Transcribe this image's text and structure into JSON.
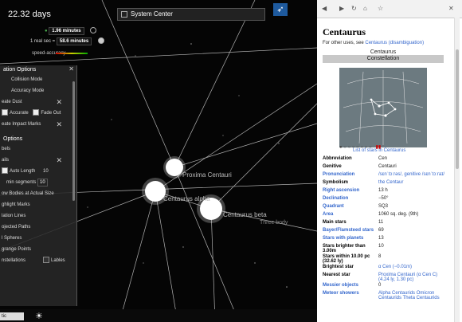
{
  "sim": {
    "elapsed": "22.32 days",
    "rate1": "1.96 minutes",
    "rate2_prefix": "1 real sec =",
    "rate2": "58.6 minutes",
    "accuracy_label": "speed-accuracy"
  },
  "tab": {
    "label": "System Center"
  },
  "stars": {
    "a": "Proxima Centauri",
    "b": "Centaurus alpha",
    "c": "Centaurus beta",
    "d": "Three body"
  },
  "panel": {
    "sim_header": "ation Options",
    "collision": "Collision Mode",
    "accuracy": "Accuracy Mode",
    "create_dust": "eate Dust",
    "accurate": "Accurate",
    "fade_out": "Fade Out",
    "impact": "eate Impact Marks",
    "view_header": "Options",
    "labels": "bels",
    "trails": "ails",
    "auto_length": "Auto Length",
    "auto_length_val": "10",
    "min_segments": "min segments",
    "min_segments_val": "10",
    "show_bodies": "ow Bodies at Actual Size",
    "highlight": "ghlight Marks",
    "relation": "lation Lines",
    "projected": "ojected Paths",
    "spheres": "l Spheres",
    "lagrange": "grange Points",
    "constellations": "nstellations",
    "lables": "Lables"
  },
  "bottom": {
    "select_value": "tic"
  },
  "wiki": {
    "title": "Centaurus",
    "dab_prefix": "For other uses, see",
    "dab_link": "Centaurus (disambiguation)",
    "ib_name": "Centaurus",
    "ib_header": "Constellation",
    "list_link": "List of stars in Centaurus",
    "rows": [
      {
        "k": "Abbreviation",
        "v": "Cen"
      },
      {
        "k": "Genitive",
        "v": "Centauri"
      },
      {
        "k": "Pronunciation",
        "v": "/sɛnˈtɔːrəs/, genitive /sɛnˈtɔːraɪ/"
      },
      {
        "k": "Symbolism",
        "v": "the Centaur"
      },
      {
        "k": "Right ascension",
        "v": "13 h"
      },
      {
        "k": "Declination",
        "v": "−50°"
      },
      {
        "k": "Quadrant",
        "v": "SQ3"
      },
      {
        "k": "Area",
        "v": "1060 sq. deg. (9th)"
      },
      {
        "k": "Main stars",
        "v": "11"
      },
      {
        "k": "Bayer/Flamsteed stars",
        "v": "69"
      },
      {
        "k": "Stars with planets",
        "v": "13"
      },
      {
        "k": "Stars brighter than 3.00m",
        "v": "10"
      },
      {
        "k": "Stars within 10.00 pc (32.62 ly)",
        "v": "8"
      },
      {
        "k": "Brightest star",
        "v": "α Cen (−0.01m)"
      },
      {
        "k": "Nearest star",
        "v": "Proxima Centauri (α Cen C) (4.24 ly, 1.30 pc)"
      },
      {
        "k": "Messier objects",
        "v": "0"
      },
      {
        "k": "Meteor showers",
        "v": "Alpha Centaurids Omicron Centaurids Theta Centaurids"
      }
    ]
  }
}
